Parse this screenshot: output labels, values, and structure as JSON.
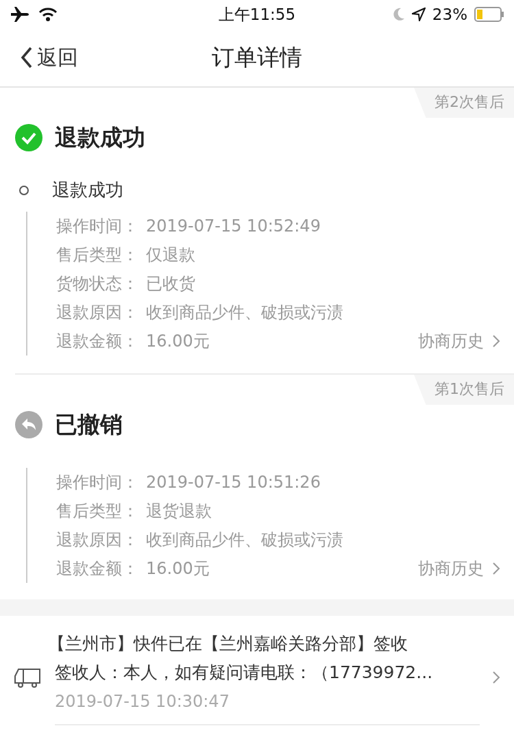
{
  "status_bar": {
    "time": "上午11:55",
    "battery": "23%"
  },
  "nav": {
    "back": "返回",
    "title": "订单详情"
  },
  "records": [
    {
      "badge": "第2次售后",
      "kind": "success",
      "title": "退款成功",
      "step": "退款成功",
      "fields": [
        {
          "label": "操作时间：",
          "value": "2019-07-15 10:52:49"
        },
        {
          "label": "售后类型：",
          "value": "仅退款"
        },
        {
          "label": "货物状态：",
          "value": "已收货"
        },
        {
          "label": "退款原因：",
          "value": "收到商品少件、破损或污渍"
        },
        {
          "label": "退款金额：",
          "value": "16.00元"
        }
      ],
      "link": "协商历史"
    },
    {
      "badge": "第1次售后",
      "kind": "revoked",
      "title": "已撤销",
      "fields": [
        {
          "label": "操作时间：",
          "value": "2019-07-15 10:51:26"
        },
        {
          "label": "售后类型：",
          "value": "退货退款"
        },
        {
          "label": "退款原因：",
          "value": "收到商品少件、破损或污渍"
        },
        {
          "label": "退款金额：",
          "value": "16.00元"
        }
      ],
      "link": "协商历史"
    }
  ],
  "delivery": {
    "message": "【兰州市】快件已在【兰州嘉峪关路分部】签收",
    "receiver": "签收人：本人，如有疑问请电联：（17739972...",
    "time": "2019-07-15 10:30:47"
  }
}
